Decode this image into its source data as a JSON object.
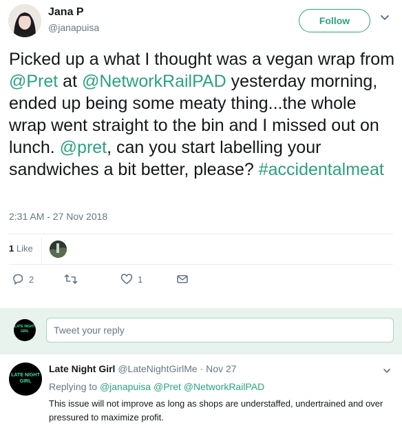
{
  "tweet": {
    "author_name": "Jana P",
    "author_handle": "@janapuisa",
    "follow_label": "Follow",
    "text_parts": {
      "p1": "Picked up a what I thought was a vegan wrap from ",
      "m1": "@Pret",
      "p2": " at ",
      "m2": "@NetworkRailPAD",
      "p3": " yesterday morning, ended up being some meaty thing...the whole wrap went straight to the bin and I missed out on lunch. ",
      "m3": "@pret",
      "p4": ", can you start labelling your sandwiches a bit better, please? ",
      "h1": "#accidentalmeat"
    },
    "timestamp": "2:31 AM - 27 Nov 2018",
    "likes_count": "1",
    "likes_label": " Like",
    "actions": {
      "reply_count": "2",
      "retweet_count": "",
      "like_count": "1"
    }
  },
  "reply_box": {
    "placeholder": "Tweet your reply",
    "avatar_text_1": "LATE NIGHT",
    "avatar_text_2": "GIRL"
  },
  "reply": {
    "author_name": "Late Night Girl",
    "author_handle": "@LateNightGirlMe",
    "separator": " · ",
    "date": "Nov 27",
    "replying_prefix": "Replying to ",
    "replying_to": [
      "@janapuisa",
      "@Pret",
      "@NetworkRailPAD"
    ],
    "text": "This issue will not improve as long as shops are understaffed, undertrained and over pressured to maximize profit.",
    "avatar_text_1": "LATE NIGHT",
    "avatar_text_2": "GIRL"
  },
  "colors": {
    "accent": "#2aa37c",
    "muted": "#657786",
    "text": "#14171a",
    "reply_bar_bg": "#e8f3ee"
  },
  "icons": [
    "user-avatar",
    "chevron-down-icon",
    "reply-icon",
    "retweet-icon",
    "heart-icon",
    "message-icon"
  ]
}
